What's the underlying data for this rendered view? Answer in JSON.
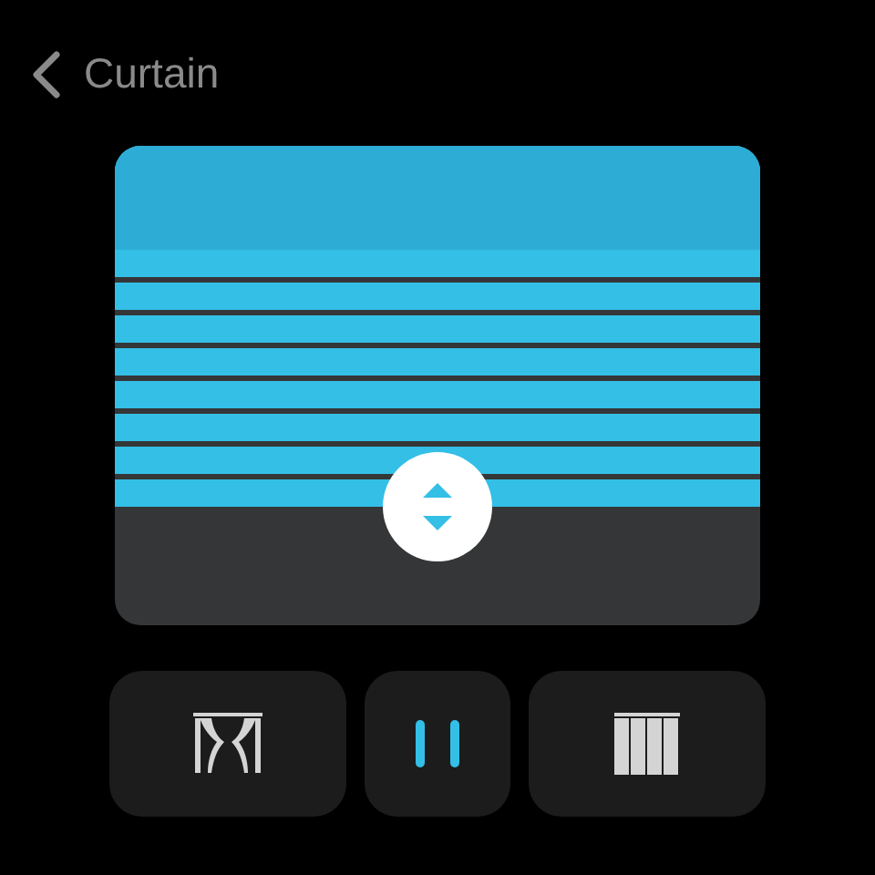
{
  "header": {
    "title": "Curtain"
  },
  "controls": [
    {
      "kind": "open"
    },
    {
      "kind": "pause"
    },
    {
      "kind": "close"
    }
  ]
}
